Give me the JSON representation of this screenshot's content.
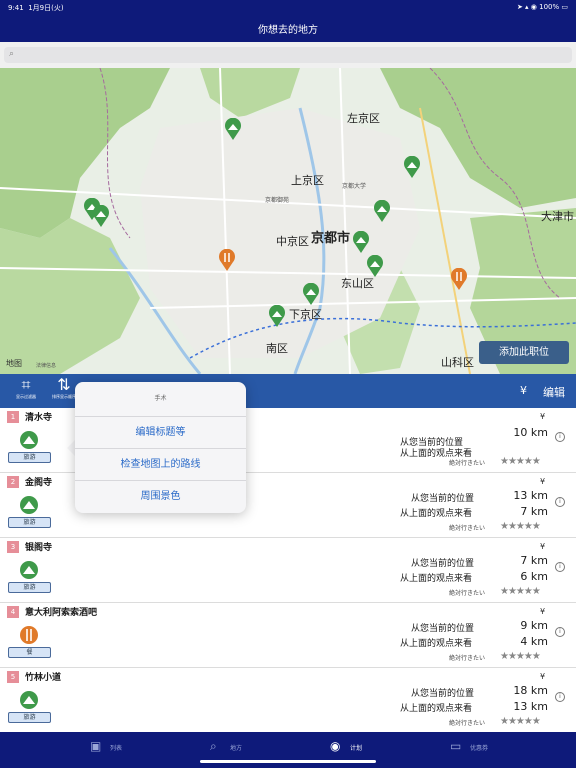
{
  "status": {
    "time": "9:41",
    "date": "1月9日(火)",
    "battery": "100%"
  },
  "header": {
    "title": "你想去的地方"
  },
  "search": {
    "placeholder": ""
  },
  "map": {
    "labels": {
      "sakyo": "左京区",
      "kamigyo": "上京区",
      "nakagyo": "中京区",
      "kyoto": "京都市",
      "higashiyama": "东山区",
      "shimogyo": "下京区",
      "minami": "南区",
      "yamashina": "山科区",
      "otsu": "大津市",
      "kyodai": "京都大学",
      "kyotogyoen": "京都御苑"
    },
    "add_button": "添加此职位",
    "logo": "地图",
    "legal": "法律信息"
  },
  "toolbar": {
    "crop_caption": "显示过滤器",
    "sort_caption": "排序显示顺序",
    "yen": "¥",
    "edit": "编辑"
  },
  "popover": {
    "title": "手术",
    "items": [
      "编辑标题等",
      "检查地图上的路线",
      "周围景色"
    ]
  },
  "places": [
    {
      "num": "1",
      "name": "清水寺",
      "tag": "旅游",
      "icon": "mountain-icon",
      "yen": "¥",
      "from_current_label": "从您当前的位置",
      "from_prev_label": "从上面的观点来看",
      "dist_current": "",
      "dist_prev": "10 km",
      "rating_label": "絶対行きたい",
      "stars": "★★★★★"
    },
    {
      "num": "2",
      "name": "金阁寺",
      "tag": "旅游",
      "icon": "mountain-icon",
      "yen": "¥",
      "from_current_label": "从您当前的位置",
      "from_prev_label": "从上面的观点来看",
      "dist_current": "13 km",
      "dist_prev": "7 km",
      "rating_label": "絶対行きたい",
      "stars": "★★★★★"
    },
    {
      "num": "3",
      "name": "银阁寺",
      "tag": "旅游",
      "icon": "mountain-icon",
      "yen": "¥",
      "from_current_label": "从您当前的位置",
      "from_prev_label": "从上面的观点来看",
      "dist_current": "7 km",
      "dist_prev": "6 km",
      "rating_label": "絶対行きたい",
      "stars": "★★★★★"
    },
    {
      "num": "4",
      "name": "意大利阿索索酒吧",
      "tag": "餐",
      "icon": "fork-knife-icon",
      "yen": "¥",
      "from_current_label": "从您当前的位置",
      "from_prev_label": "从上面的观点来看",
      "dist_current": "9 km",
      "dist_prev": "4 km",
      "rating_label": "絶対行きたい",
      "stars": "★★★★★"
    },
    {
      "num": "5",
      "name": "竹林小道",
      "tag": "旅游",
      "icon": "mountain-icon",
      "yen": "¥",
      "from_current_label": "从您当前的位置",
      "from_prev_label": "从上面的观点来看",
      "dist_current": "18 km",
      "dist_prev": "13 km",
      "rating_label": "絶対行きたい",
      "stars": "★★★★★"
    }
  ],
  "tabs": [
    {
      "label": "列表",
      "icon": "photo-icon"
    },
    {
      "label": "地方",
      "icon": "search-icon"
    },
    {
      "label": "计划",
      "icon": "plan-icon"
    },
    {
      "label": "优惠券",
      "icon": "card-icon"
    }
  ],
  "colors": {
    "nav": "#0e1a7a",
    "toolbar": "#2858a6",
    "pin_green": "#3f9a4a",
    "pin_orange": "#e07a2a",
    "num_badge": "#e68e98"
  }
}
